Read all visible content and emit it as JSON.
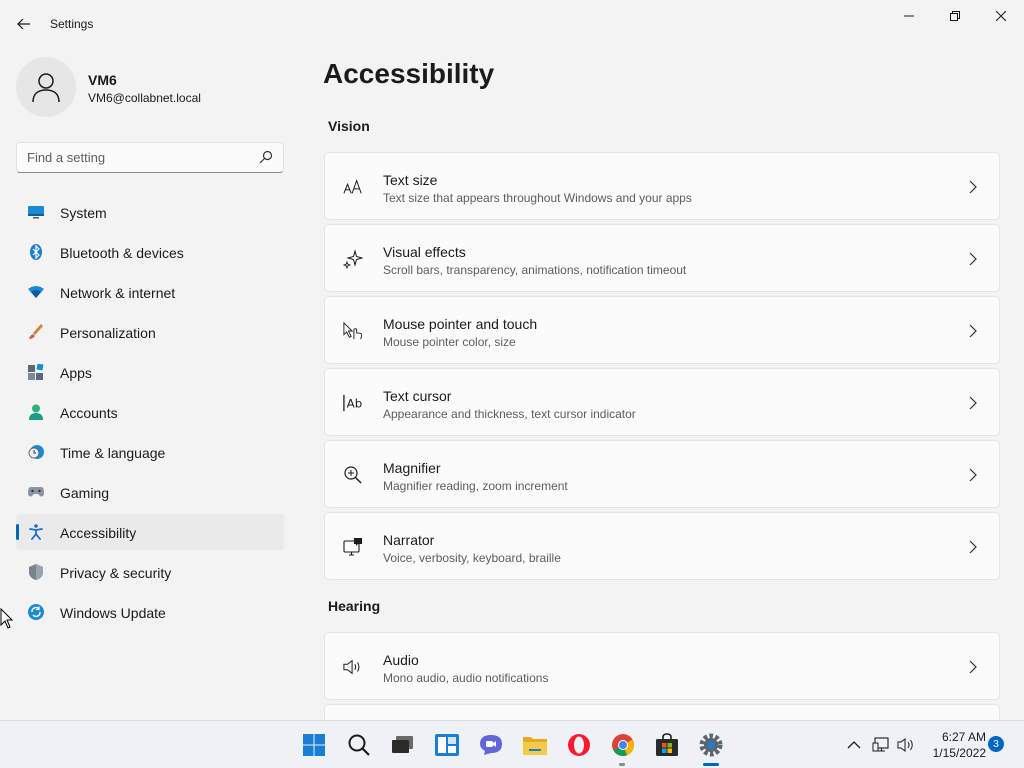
{
  "window": {
    "title": "Settings",
    "back_icon": "arrow-left-icon",
    "controls": [
      "minimize-icon",
      "restore-icon",
      "close-icon"
    ]
  },
  "user": {
    "name": "VM6",
    "email": "VM6@collabnet.local",
    "avatar_icon": "person-icon"
  },
  "search": {
    "placeholder": "Find a setting",
    "value": "",
    "icon": "search-icon"
  },
  "sidebar": {
    "items": [
      {
        "label": "System",
        "icon": "system-icon",
        "active": false
      },
      {
        "label": "Bluetooth & devices",
        "icon": "bluetooth-icon",
        "active": false
      },
      {
        "label": "Network & internet",
        "icon": "wifi-icon",
        "active": false
      },
      {
        "label": "Personalization",
        "icon": "brush-icon",
        "active": false
      },
      {
        "label": "Apps",
        "icon": "apps-icon",
        "active": false
      },
      {
        "label": "Accounts",
        "icon": "account-icon",
        "active": false
      },
      {
        "label": "Time & language",
        "icon": "clock-globe-icon",
        "active": false
      },
      {
        "label": "Gaming",
        "icon": "gamepad-icon",
        "active": false
      },
      {
        "label": "Accessibility",
        "icon": "accessibility-icon",
        "active": true
      },
      {
        "label": "Privacy & security",
        "icon": "shield-icon",
        "active": false
      },
      {
        "label": "Windows Update",
        "icon": "update-icon",
        "active": false
      }
    ],
    "accent_color": "#0067c0"
  },
  "main": {
    "title": "Accessibility",
    "sections": [
      {
        "title": "Vision",
        "cards": [
          {
            "title": "Text size",
            "description": "Text size that appears throughout Windows and your apps",
            "icon": "text-size-icon"
          },
          {
            "title": "Visual effects",
            "description": "Scroll bars, transparency, animations, notification timeout",
            "icon": "sparkle-icon"
          },
          {
            "title": "Mouse pointer and touch",
            "description": "Mouse pointer color, size",
            "icon": "pointer-touch-icon"
          },
          {
            "title": "Text cursor",
            "description": "Appearance and thickness, text cursor indicator",
            "icon": "text-cursor-icon"
          },
          {
            "title": "Magnifier",
            "description": "Magnifier reading, zoom increment",
            "icon": "magnifier-icon"
          },
          {
            "title": "Narrator",
            "description": "Voice, verbosity, keyboard, braille",
            "icon": "narrator-icon"
          }
        ]
      },
      {
        "title": "Hearing",
        "cards": [
          {
            "title": "Audio",
            "description": "Mono audio, audio notifications",
            "icon": "speaker-icon"
          }
        ]
      }
    ]
  },
  "taskbar": {
    "apps": [
      "start-icon",
      "search-icon",
      "task-view-icon",
      "widgets-icon",
      "chat-icon",
      "file-explorer-icon",
      "opera-icon",
      "chrome-icon",
      "store-icon",
      "settings-icon"
    ],
    "tray": [
      "chevron-up-icon",
      "network-icon",
      "volume-icon"
    ],
    "time": "6:27 AM",
    "date": "1/15/2022",
    "notification_count": "3"
  }
}
